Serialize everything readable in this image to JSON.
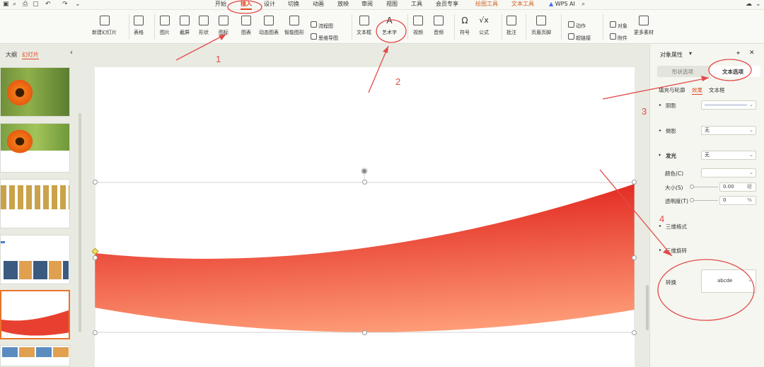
{
  "menubar": {
    "tabs": [
      "开始",
      "插入",
      "设计",
      "切换",
      "动画",
      "放映",
      "审阅",
      "视图",
      "工具",
      "会员专享",
      "绘图工具",
      "文本工具",
      "WPS AI"
    ],
    "active_tab": "插入"
  },
  "ribbon": {
    "new_slide": "新建幻灯片",
    "table": "表格",
    "picture": "图片",
    "screenshot": "截屏",
    "shape": "形状",
    "icon": "图标",
    "chart": "图表",
    "dynamic_chart": "动态图表",
    "smart_graphic": "智能图形",
    "flowchart": "流程图",
    "mindmap": "思维导图",
    "textbox": "文本框",
    "art_text": "艺术字",
    "video": "视频",
    "audio": "音频",
    "symbol": "符号",
    "formula": "公式",
    "comment": "批注",
    "header_footer": "页眉页脚",
    "action": "动作",
    "hyperlink": "超链接",
    "object": "对象",
    "attachment": "附件",
    "more_material": "更多素材"
  },
  "left_panel": {
    "tab_outline": "大纲",
    "tab_slides": "幻灯片",
    "collapse_icon": "chevron-left-icon"
  },
  "right_panel": {
    "title": "对象属性",
    "tab_shape": "形状选项",
    "tab_text": "文本选项",
    "subtab_fill": "填充与轮廓",
    "subtab_effect": "效果",
    "subtab_textbox": "文本框",
    "shadow_label": "阴影",
    "reflection_label": "倒影",
    "reflection_value": "无",
    "glow_label": "发光",
    "glow_value": "无",
    "color_label": "颜色(C)",
    "size_label": "大小(S)",
    "size_value": "0.00",
    "size_unit": "磅",
    "transparency_label": "透明度(T)",
    "transparency_value": "0",
    "transparency_unit": "%",
    "three_d_format": "三维格式",
    "three_d_rotation": "三维旋转",
    "transform_label": "转换",
    "transform_value": "abcde"
  },
  "annotations": {
    "n1": "1",
    "n2": "2",
    "n3": "3",
    "n4": "4"
  },
  "colors": {
    "accent": "#e1451f",
    "annotation": "#e24a4a",
    "banner_top": "#e0201a",
    "banner_bottom": "#ffa07a"
  }
}
